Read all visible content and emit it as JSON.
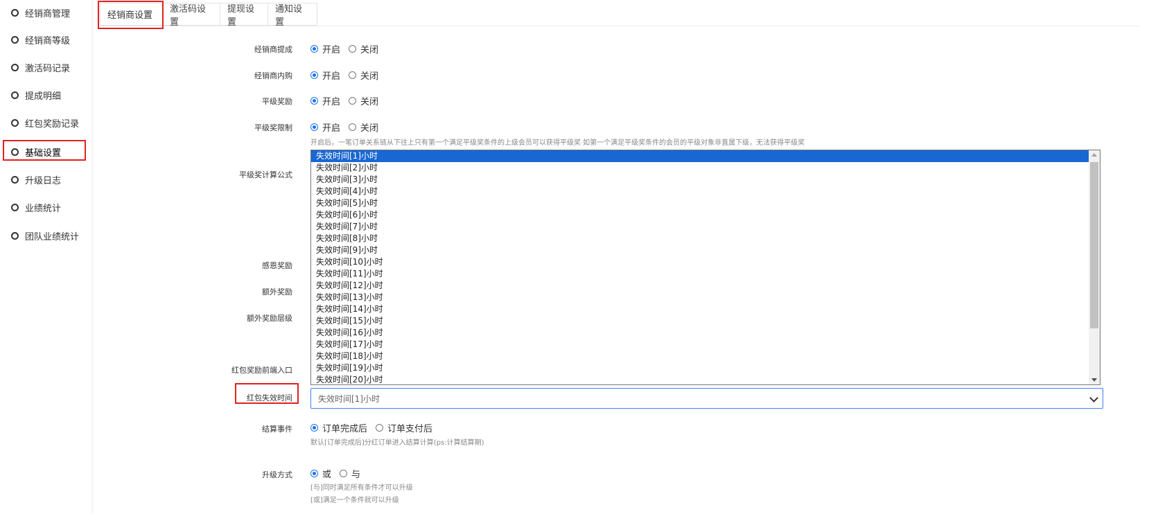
{
  "sidebar": {
    "items": [
      {
        "label": "经销商管理"
      },
      {
        "label": "经销商等级"
      },
      {
        "label": "激活码记录"
      },
      {
        "label": "提成明细"
      },
      {
        "label": "红包奖励记录"
      },
      {
        "label": "基础设置",
        "active": true
      },
      {
        "label": "升级日志"
      },
      {
        "label": "业绩统计"
      },
      {
        "label": "团队业绩统计"
      }
    ]
  },
  "tabs": [
    {
      "label": "经销商设置",
      "active": true
    },
    {
      "label": "激活码设置"
    },
    {
      "label": "提现设置"
    },
    {
      "label": "通知设置"
    }
  ],
  "form": {
    "commission": {
      "label": "经销商提成",
      "on": "开启",
      "off": "关闭"
    },
    "inner_purchase": {
      "label": "经销商内购",
      "on": "开启",
      "off": "关闭"
    },
    "peer_reward": {
      "label": "平级奖励",
      "on": "开启",
      "off": "关闭"
    },
    "peer_limit": {
      "label": "平级奖限制",
      "on": "开启",
      "off": "关闭",
      "hint": "开启后，一笔订单关系链从下往上只有第一个满足平级奖条件的上级会员可以获得平级奖 如第一个满足平级奖条件的会员的平级对象非直属下级，无法获得平级奖"
    },
    "peer_formula": {
      "label": "平级奖计算公式"
    },
    "gratitude_reward": {
      "label": "感恩奖励"
    },
    "extra_reward": {
      "label": "额外奖励"
    },
    "extra_reward_level": {
      "label": "额外奖励层级"
    },
    "redpacket_entry": {
      "label": "红包奖励前端入口"
    },
    "redpacket_expire": {
      "label": "红包失效时间",
      "selected": "失效时间[1]小时",
      "options": [
        "失效时间[1]小时",
        "失效时间[2]小时",
        "失效时间[3]小时",
        "失效时间[4]小时",
        "失效时间[5]小时",
        "失效时间[6]小时",
        "失效时间[7]小时",
        "失效时间[8]小时",
        "失效时间[9]小时",
        "失效时间[10]小时",
        "失效时间[11]小时",
        "失效时间[12]小时",
        "失效时间[13]小时",
        "失效时间[14]小时",
        "失效时间[15]小时",
        "失效时间[16]小时",
        "失效时间[17]小时",
        "失效时间[18]小时",
        "失效时间[19]小时",
        "失效时间[20]小时"
      ]
    },
    "settlement": {
      "label": "结算事件",
      "opt1": "订单完成后",
      "opt2": "订单支付后",
      "hint": "默认[订单完成后]分红订单进入结算计算(ps:计算结算期)"
    },
    "upgrade_mode": {
      "label": "升级方式",
      "opt1": "或",
      "opt2": "与",
      "hint1": "[与]同时满足所有条件才可以升级",
      "hint2": "[或]满足一个条件就可以升级"
    }
  },
  "colors": {
    "highlight_box": "#e02020",
    "accent": "#1a73e8",
    "selected_option": "#1967d2"
  }
}
